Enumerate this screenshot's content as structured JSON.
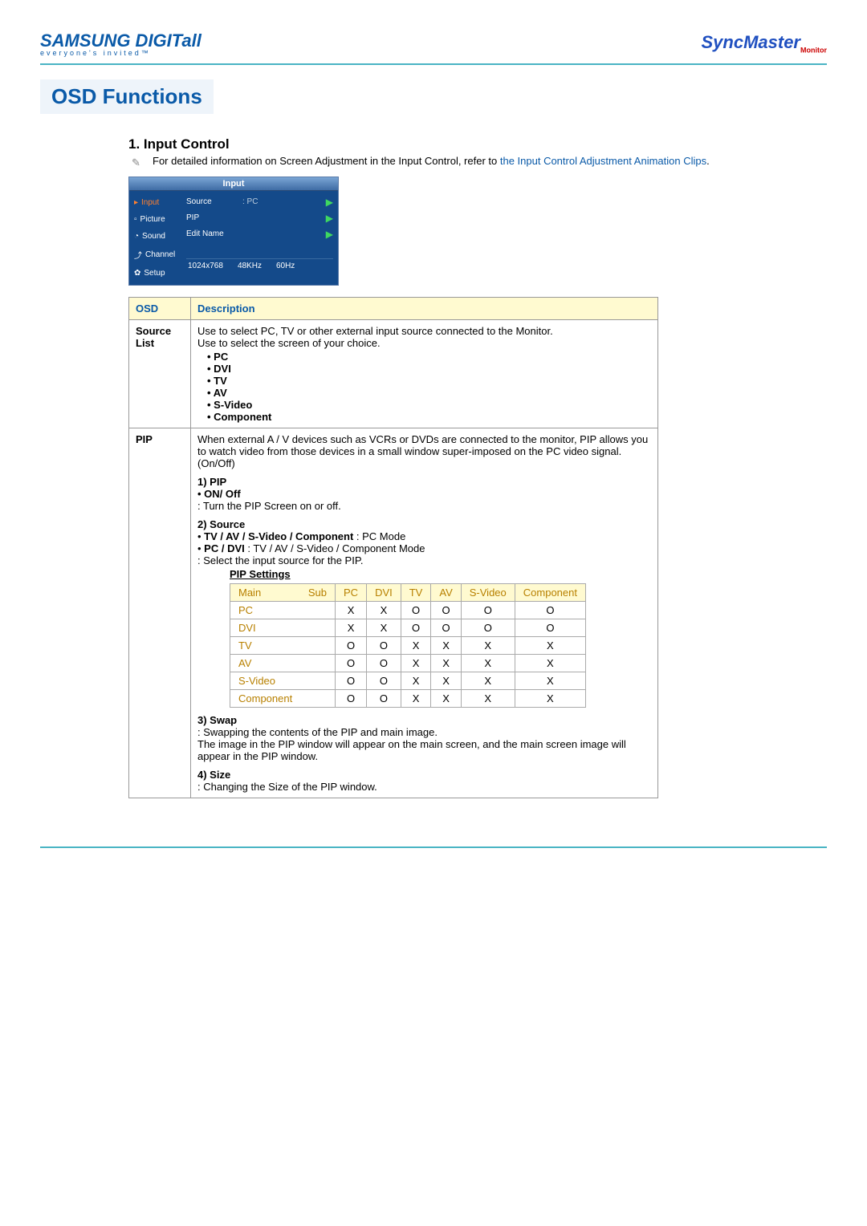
{
  "branding": {
    "left_logo": "SAMSUNG DIGITall",
    "left_tag": "everyone's invited™",
    "right_logo": "SyncMaster",
    "right_sub": "Monitor"
  },
  "title": "OSD Functions",
  "section": {
    "heading": "1. Input Control",
    "intro_text": "For detailed information on Screen Adjustment in the Input Control, refer to ",
    "intro_link": "the Input Control Adjustment Animation Clips",
    "intro_period": "."
  },
  "osd_shot": {
    "title": "Input",
    "side": [
      "Input",
      "Picture",
      "Sound",
      "Channel",
      "Setup"
    ],
    "rows": [
      {
        "label": "Source",
        "value": ": PC"
      },
      {
        "label": "PIP",
        "value": ""
      },
      {
        "label": "Edit Name",
        "value": ""
      }
    ],
    "status": [
      "1024x768",
      "48KHz",
      "60Hz"
    ]
  },
  "table_headers": {
    "osd": "OSD",
    "desc": "Description"
  },
  "rows": {
    "source": {
      "name": "Source List",
      "desc1": "Use to select PC, TV or other external input source connected to the Monitor.",
      "desc2": "Use to select the screen of your choice.",
      "items": [
        "PC",
        "DVI",
        "TV",
        "AV",
        "S-Video",
        "Component"
      ]
    },
    "pip": {
      "name": "PIP",
      "desc": "When external A / V devices such as VCRs or DVDs are connected to the monitor, PIP allows you to watch video from those devices in a small window super-imposed on the PC video signal. (On/Off)",
      "s1_title": "1) PIP",
      "s1_bullet": "ON/ Off",
      "s1_desc": ": Turn the PIP Screen on or off.",
      "s2_title": "2) Source",
      "s2_b1_bold": "TV / AV / S-Video / Component",
      "s2_b1_rest": " : PC Mode",
      "s2_b2_bold": "PC / DVI",
      "s2_b2_rest": " : TV / AV / S-Video / Component Mode",
      "s2_desc": ": Select the input source for the PIP.",
      "settings_caption": "PIP Settings",
      "corner_sub": "Sub",
      "corner_main": "Main",
      "cols": [
        "PC",
        "DVI",
        "TV",
        "AV",
        "S-Video",
        "Component"
      ],
      "matrix": [
        {
          "name": "PC",
          "cells": [
            "X",
            "X",
            "O",
            "O",
            "O",
            "O"
          ]
        },
        {
          "name": "DVI",
          "cells": [
            "X",
            "X",
            "O",
            "O",
            "O",
            "O"
          ]
        },
        {
          "name": "TV",
          "cells": [
            "O",
            "O",
            "X",
            "X",
            "X",
            "X"
          ]
        },
        {
          "name": "AV",
          "cells": [
            "O",
            "O",
            "X",
            "X",
            "X",
            "X"
          ]
        },
        {
          "name": "S-Video",
          "cells": [
            "O",
            "O",
            "X",
            "X",
            "X",
            "X"
          ]
        },
        {
          "name": "Component",
          "cells": [
            "O",
            "O",
            "X",
            "X",
            "X",
            "X"
          ]
        }
      ],
      "s3_title": "3) Swap",
      "s3_l1": ": Swapping the contents of the PIP and main image.",
      "s3_l2": "The image in the PIP window will appear on the main screen, and the main screen image will appear in the PIP window.",
      "s4_title": "4) Size",
      "s4_l1": ": Changing the Size of the PIP window."
    }
  }
}
